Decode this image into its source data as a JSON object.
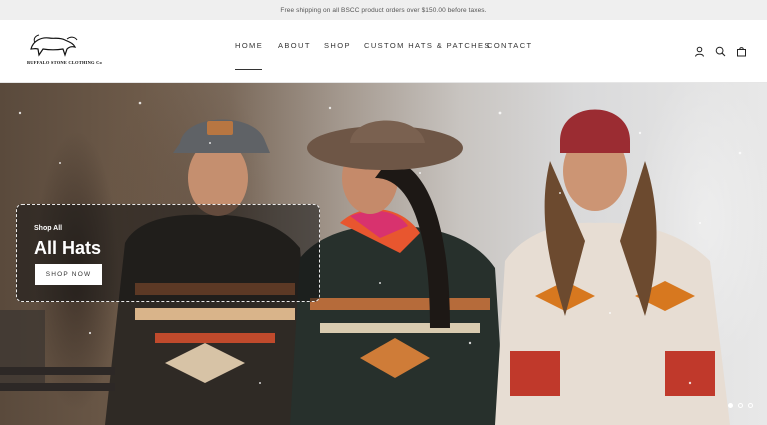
{
  "announcement": "Free shipping on all BSCC product orders over $150.00 before taxes.",
  "brand": {
    "name": "BUFFALO STONE CLOTHING Co"
  },
  "nav": {
    "items": [
      {
        "label": "HOME",
        "active": true
      },
      {
        "label": "ABOUT",
        "active": false
      },
      {
        "label": "SHOP",
        "active": false
      },
      {
        "label": "CUSTOM HATS & PATCHES",
        "active": false
      },
      {
        "label": "CONTACT",
        "active": false
      }
    ]
  },
  "header_icons": [
    "account-icon",
    "search-icon",
    "cart-icon"
  ],
  "hero": {
    "eyebrow": "Shop All",
    "title": "All Hats",
    "button_label": "SHOP NOW",
    "slides": {
      "count": 3,
      "active": 1
    }
  },
  "colors": {
    "announcement_bg": "#efefef",
    "text": "#333333",
    "promo_overlay": "rgba(20,20,20,0.55)"
  }
}
